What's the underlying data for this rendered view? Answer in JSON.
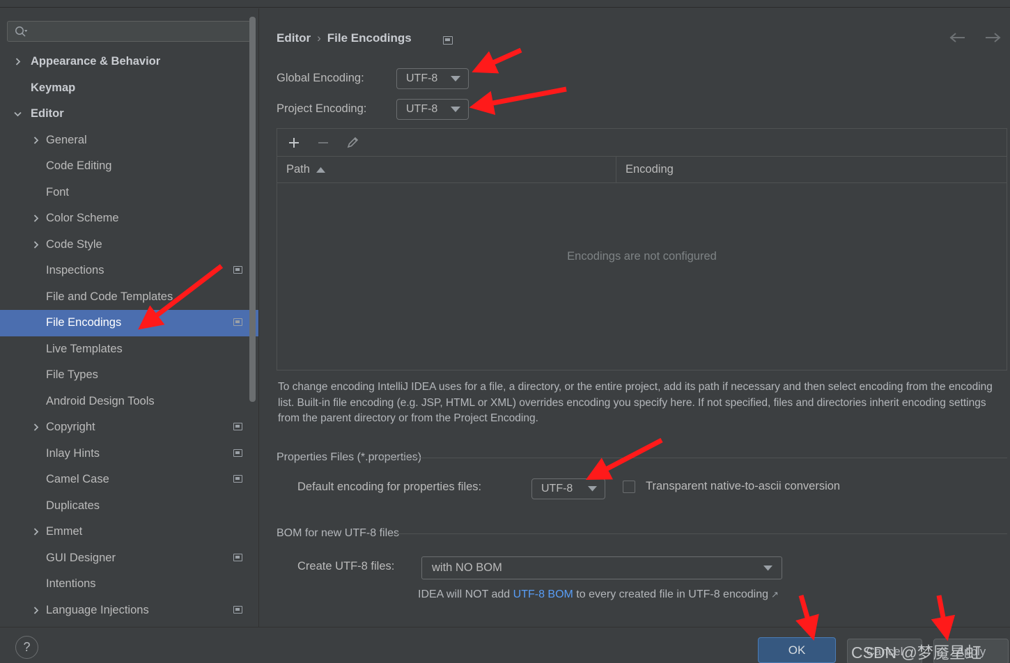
{
  "window": {
    "logo": "intellij-idea-logo"
  },
  "search": {
    "placeholder": "",
    "value": "",
    "icon": "search-icon"
  },
  "sidebar": {
    "items": [
      {
        "label": "Appearance & Behavior",
        "depth": 0,
        "chevron": "right",
        "bold": true,
        "badge": false,
        "selected": false
      },
      {
        "label": "Keymap",
        "depth": 0,
        "chevron": "",
        "bold": true,
        "badge": false,
        "selected": false
      },
      {
        "label": "Editor",
        "depth": 0,
        "chevron": "down",
        "bold": true,
        "badge": false,
        "selected": false
      },
      {
        "label": "General",
        "depth": 1,
        "chevron": "right",
        "bold": false,
        "badge": false,
        "selected": false
      },
      {
        "label": "Code Editing",
        "depth": 1,
        "chevron": "",
        "bold": false,
        "badge": false,
        "selected": false
      },
      {
        "label": "Font",
        "depth": 1,
        "chevron": "",
        "bold": false,
        "badge": false,
        "selected": false
      },
      {
        "label": "Color Scheme",
        "depth": 1,
        "chevron": "right",
        "bold": false,
        "badge": false,
        "selected": false
      },
      {
        "label": "Code Style",
        "depth": 1,
        "chevron": "right",
        "bold": false,
        "badge": false,
        "selected": false
      },
      {
        "label": "Inspections",
        "depth": 1,
        "chevron": "",
        "bold": false,
        "badge": true,
        "selected": false
      },
      {
        "label": "File and Code Templates",
        "depth": 1,
        "chevron": "",
        "bold": false,
        "badge": false,
        "selected": false
      },
      {
        "label": "File Encodings",
        "depth": 1,
        "chevron": "",
        "bold": false,
        "badge": true,
        "selected": true
      },
      {
        "label": "Live Templates",
        "depth": 1,
        "chevron": "",
        "bold": false,
        "badge": false,
        "selected": false
      },
      {
        "label": "File Types",
        "depth": 1,
        "chevron": "",
        "bold": false,
        "badge": false,
        "selected": false
      },
      {
        "label": "Android Design Tools",
        "depth": 1,
        "chevron": "",
        "bold": false,
        "badge": false,
        "selected": false
      },
      {
        "label": "Copyright",
        "depth": 1,
        "chevron": "right",
        "bold": false,
        "badge": true,
        "selected": false
      },
      {
        "label": "Inlay Hints",
        "depth": 1,
        "chevron": "",
        "bold": false,
        "badge": true,
        "selected": false
      },
      {
        "label": "Camel Case",
        "depth": 1,
        "chevron": "",
        "bold": false,
        "badge": true,
        "selected": false
      },
      {
        "label": "Duplicates",
        "depth": 1,
        "chevron": "",
        "bold": false,
        "badge": false,
        "selected": false
      },
      {
        "label": "Emmet",
        "depth": 1,
        "chevron": "right",
        "bold": false,
        "badge": false,
        "selected": false
      },
      {
        "label": "GUI Designer",
        "depth": 1,
        "chevron": "",
        "bold": false,
        "badge": true,
        "selected": false
      },
      {
        "label": "Intentions",
        "depth": 1,
        "chevron": "",
        "bold": false,
        "badge": false,
        "selected": false
      },
      {
        "label": "Language Injections",
        "depth": 1,
        "chevron": "right",
        "bold": false,
        "badge": true,
        "selected": false
      }
    ]
  },
  "breadcrumb": {
    "parent": "Editor",
    "separator": "›",
    "current": "File Encodings"
  },
  "main": {
    "global_encoding_label": "Global Encoding:",
    "global_encoding_value": "UTF-8",
    "project_encoding_label": "Project Encoding:",
    "project_encoding_value": "UTF-8",
    "toolbar": {
      "add": "+",
      "remove": "−",
      "edit": "edit-pencil-icon"
    },
    "table": {
      "columns": [
        "Path",
        "Encoding"
      ],
      "sort_column": "Path",
      "sort_direction": "ascending",
      "rows": [],
      "empty_message": "Encodings are not configured"
    },
    "description": "To change encoding IntelliJ IDEA uses for a file, a directory, or the entire project, add its path if necessary and then select encoding from the encoding list. Built-in file encoding (e.g. JSP, HTML or XML) overrides encoding you specify here. If not specified, files and directories inherit encoding settings from the parent directory or from the Project Encoding.",
    "properties_group": {
      "title": "Properties Files (*.properties)",
      "default_encoding_label": "Default encoding for properties files:",
      "default_encoding_value": "UTF-8",
      "transparent_checkbox_label": "Transparent native-to-ascii conversion",
      "transparent_checkbox_checked": false
    },
    "bom_group": {
      "title": "BOM for new UTF-8 files",
      "create_label": "Create UTF-8 files:",
      "create_value": "with NO BOM",
      "note_prefix": "IDEA will NOT add ",
      "note_link": "UTF-8 BOM",
      "note_suffix": " to every created file in UTF-8 encoding",
      "external_link_icon": "↗"
    }
  },
  "footer": {
    "help_label": "?",
    "ok_label": "OK",
    "cancel_label": "Cancel",
    "apply_label": "Apply"
  },
  "watermark": {
    "text": "CSDN @梦魇星虹"
  },
  "annotations": {
    "color": "#ff1a1a",
    "arrows": [
      {
        "name": "arrow-to-global-encoding"
      },
      {
        "name": "arrow-to-project-encoding"
      },
      {
        "name": "arrow-to-file-encodings-item"
      },
      {
        "name": "arrow-to-properties-encoding"
      },
      {
        "name": "arrow-to-ok-button"
      },
      {
        "name": "arrow-to-apply-button"
      }
    ]
  },
  "colors": {
    "background": "#3c3f41",
    "selection": "#4b6eaf",
    "accent_button": "#365880",
    "link": "#589df6",
    "annotation_red": "#ff1a1a"
  }
}
